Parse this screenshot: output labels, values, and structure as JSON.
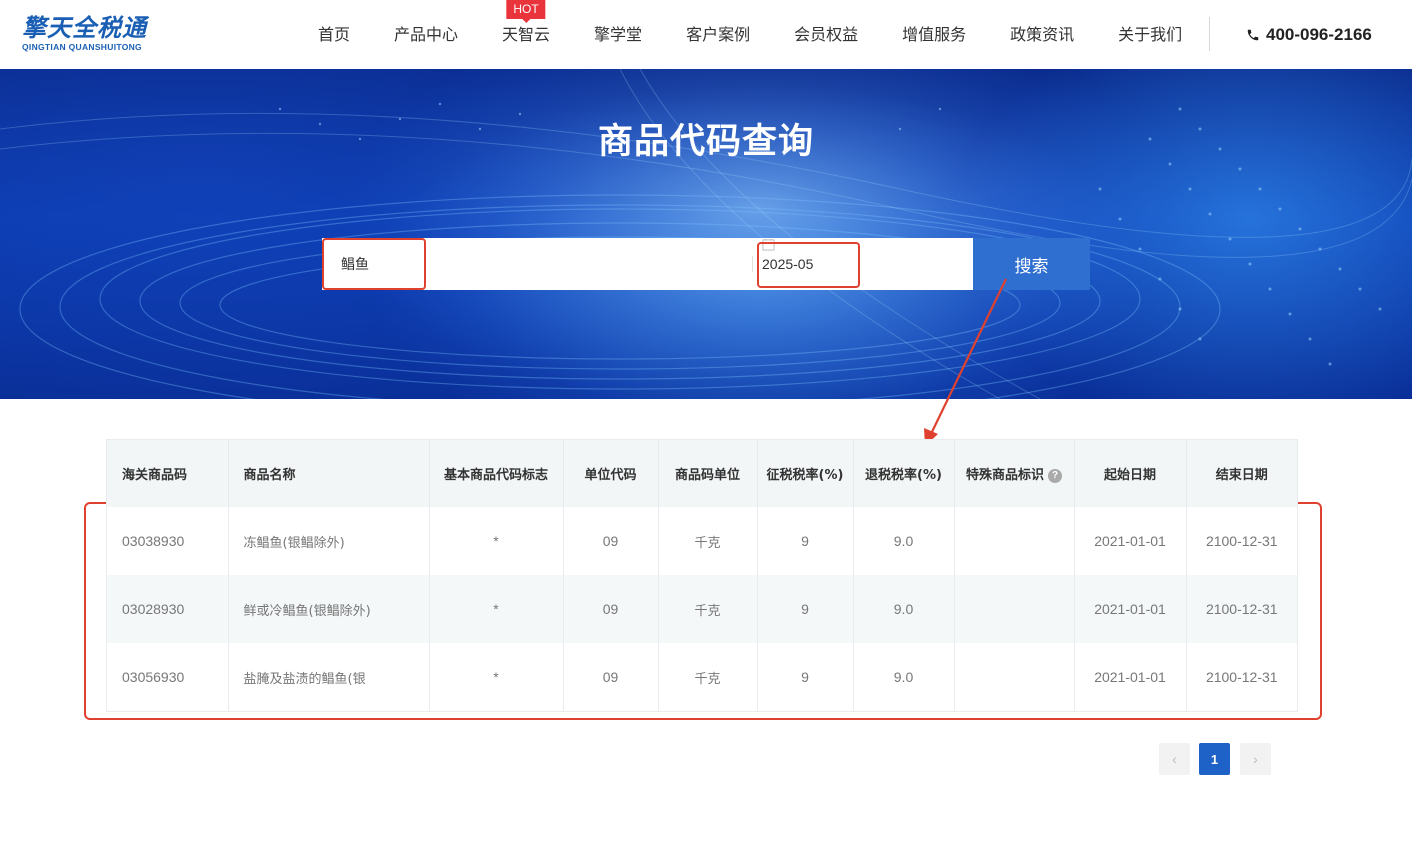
{
  "header": {
    "logo": {
      "main": "擎天全税通",
      "sub": "QINGTIAN QUANSHUITONG"
    },
    "nav": [
      {
        "label": "首页",
        "badge": ""
      },
      {
        "label": "产品中心",
        "badge": ""
      },
      {
        "label": "天智云",
        "badge": "HOT"
      },
      {
        "label": "擎学堂",
        "badge": ""
      },
      {
        "label": "客户案例",
        "badge": ""
      },
      {
        "label": "会员权益",
        "badge": ""
      },
      {
        "label": "增值服务",
        "badge": ""
      },
      {
        "label": "政策资讯",
        "badge": ""
      },
      {
        "label": "关于我们",
        "badge": ""
      }
    ],
    "phone": "400-096-2166"
  },
  "banner": {
    "title": "商品代码查询",
    "search": {
      "value": "鲳鱼",
      "date": "2025-05",
      "button": "搜索"
    }
  },
  "table": {
    "columns": [
      "海关商品码",
      "商品名称",
      "基本商品代码标志",
      "单位代码",
      "商品码单位",
      "征税税率(%)",
      "退税税率(%)",
      "特殊商品标识",
      "起始日期",
      "结束日期"
    ],
    "rows": [
      [
        "03038930",
        "冻鲳鱼(银鲳除外)",
        "*",
        "09",
        "千克",
        "9",
        "9.0",
        "",
        "2021-01-01",
        "2100-12-31"
      ],
      [
        "03028930",
        "鲜或冷鲳鱼(银鲳除外)",
        "*",
        "09",
        "千克",
        "9",
        "9.0",
        "",
        "2021-01-01",
        "2100-12-31"
      ],
      [
        "03056930",
        "盐腌及盐渍的鲳鱼(银",
        "*",
        "09",
        "千克",
        "9",
        "9.0",
        "",
        "2021-01-01",
        "2100-12-31"
      ]
    ]
  },
  "pagination": {
    "prev": "‹",
    "current": "1",
    "next": "›"
  },
  "colors": {
    "accent": "#1e62c7",
    "highlight": "#e0412f",
    "hot": "#e8343a"
  }
}
